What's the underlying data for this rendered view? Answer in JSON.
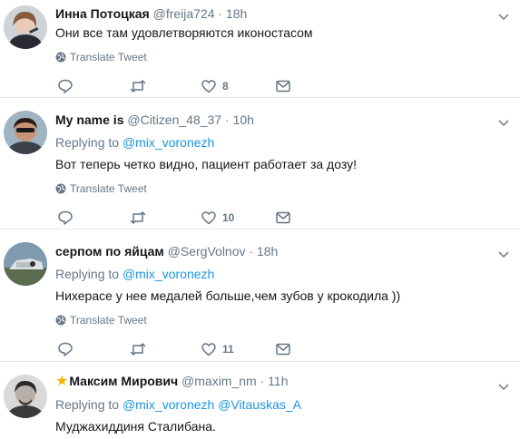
{
  "tweets": [
    {
      "name": "Инна Потоцкая",
      "handle": "@freija724",
      "separator": "·",
      "time": "18h",
      "text": "Они все там удовлетворяются иконостасом",
      "translate": "Translate Tweet",
      "likes": "8"
    },
    {
      "name": "My name is",
      "handle": "@Citizen_48_37",
      "separator": "·",
      "time": "10h",
      "replying_label": "Replying to",
      "replying_to": "@mix_voronezh",
      "text": "Вот теперь четко видно, пациент работает за дозу!",
      "translate": "Translate Tweet",
      "likes": "10"
    },
    {
      "name": "серпом по яйцам",
      "handle": "@SergVolnov",
      "separator": "·",
      "time": "18h",
      "replying_label": "Replying to",
      "replying_to": "@mix_voronezh",
      "text": "Нихерасе у нее медалей больше,чем зубов у крокодила ))",
      "translate": "Translate Tweet",
      "likes": "11"
    },
    {
      "star": "★",
      "name": "Максим Мирович",
      "handle": "@maxim_nm",
      "separator": "·",
      "time": "11h",
      "replying_label": "Replying to",
      "replying_to": "@mix_voronezh",
      "replying_to_2": "@Vitauskas_A",
      "text": "Муджахиддиня Сталибана."
    }
  ],
  "icons": {
    "reply": "reply-icon",
    "retweet": "retweet-icon",
    "like": "heart-icon",
    "message": "direct-message-icon",
    "globe": "globe-icon",
    "menu": "chevron-down-icon"
  },
  "colors": {
    "link": "#1b95e0",
    "secondary": "#657786",
    "text": "#14171a",
    "divider": "#e6ecf0",
    "star": "#f5b400"
  }
}
